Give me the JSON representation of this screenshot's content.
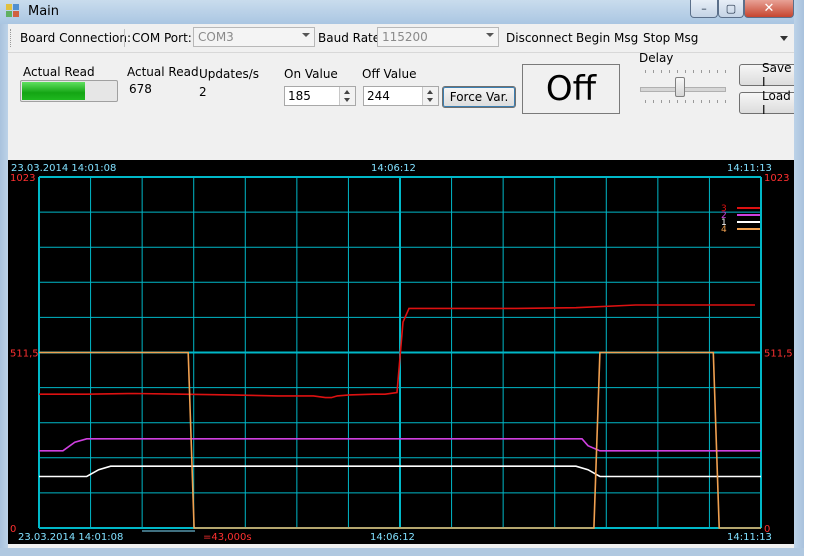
{
  "window": {
    "title": "Main",
    "close_glyph": "✕",
    "max_glyph": "▢",
    "min_glyph": "–"
  },
  "toolbar": {
    "board_connection_label": "Board Connection:",
    "com_port_label": "COM Port:",
    "com_port_value": "COM3",
    "baud_rate_label": "Baud Rate:",
    "baud_rate_value": "115200",
    "disconnect_label": "Disconnect",
    "begin_msg_label": "Begin Msg",
    "stop_msg_label": "Stop Msg"
  },
  "readout": {
    "actual_read_label": "Actual Read",
    "actual_read_value_label": "Actual Read",
    "actual_read_value": "678",
    "progress_fraction": 0.66,
    "updates_label": "Updates/s",
    "updates_value": "2"
  },
  "thresholds": {
    "on_label": "On Value",
    "on_value": "185",
    "off_label": "Off Value",
    "off_value": "244",
    "force_label": "Force Var."
  },
  "status": {
    "state": "Off"
  },
  "delay": {
    "label": "Delay",
    "fraction": 0.5
  },
  "side_buttons": {
    "save_label": "Save I",
    "load_label": "Load I"
  },
  "colors": {
    "series_red": "#dd1111",
    "series_magenta": "#d040e0",
    "series_white": "#ffffff",
    "series_orange": "#f0a050",
    "grid": "#00b8c8",
    "axis_text": "#ff3030",
    "time_text": "#80e0ff"
  },
  "chart_data": {
    "type": "line",
    "x_start_label": "23.03.2014 14:01:08",
    "x_mid_label": "14:06:12",
    "x_end_label": "14:11:13",
    "bottom_mid_label": "14:06:12",
    "bottom_end_label": "14:11:13",
    "bottom_start_label": "23.03.2014 14:01:08",
    "scale_label": "=43,000s",
    "ylim": [
      0,
      1023
    ],
    "y_ticks": [
      "1023",
      "511,5",
      "0"
    ],
    "x_range": [
      0,
      605
    ],
    "legend": [
      "3",
      "2",
      "1",
      "4"
    ],
    "series": [
      {
        "name": "3",
        "color": "#dd1111",
        "x": [
          0,
          40,
          80,
          120,
          160,
          200,
          230,
          240,
          245,
          250,
          260,
          280,
          290,
          300,
          305,
          310,
          318,
          330,
          350,
          400,
          450,
          500,
          550,
          600
        ],
        "y": [
          390,
          390,
          392,
          390,
          388,
          385,
          385,
          380,
          380,
          385,
          388,
          390,
          390,
          395,
          600,
          640,
          640,
          640,
          640,
          640,
          642,
          650,
          650,
          650
        ]
      },
      {
        "name": "2",
        "color": "#d040e0",
        "x": [
          0,
          20,
          30,
          40,
          80,
          150,
          300,
          450,
          455,
          460,
          470,
          560,
          605
        ],
        "y": [
          225,
          225,
          250,
          260,
          260,
          260,
          260,
          260,
          260,
          240,
          225,
          225,
          225
        ]
      },
      {
        "name": "1",
        "color": "#ffffff",
        "x": [
          0,
          40,
          50,
          60,
          100,
          200,
          300,
          450,
          460,
          470,
          560,
          605
        ],
        "y": [
          150,
          150,
          170,
          180,
          180,
          180,
          180,
          180,
          170,
          150,
          150,
          150
        ]
      },
      {
        "name": "4",
        "color": "#f0a050",
        "x": [
          0,
          120,
          125,
          130,
          460,
          465,
          470,
          560,
          565,
          570,
          600,
          605
        ],
        "y": [
          511.5,
          511.5,
          511.5,
          0,
          0,
          0,
          511.5,
          511.5,
          511.5,
          0,
          0,
          0
        ]
      }
    ]
  }
}
